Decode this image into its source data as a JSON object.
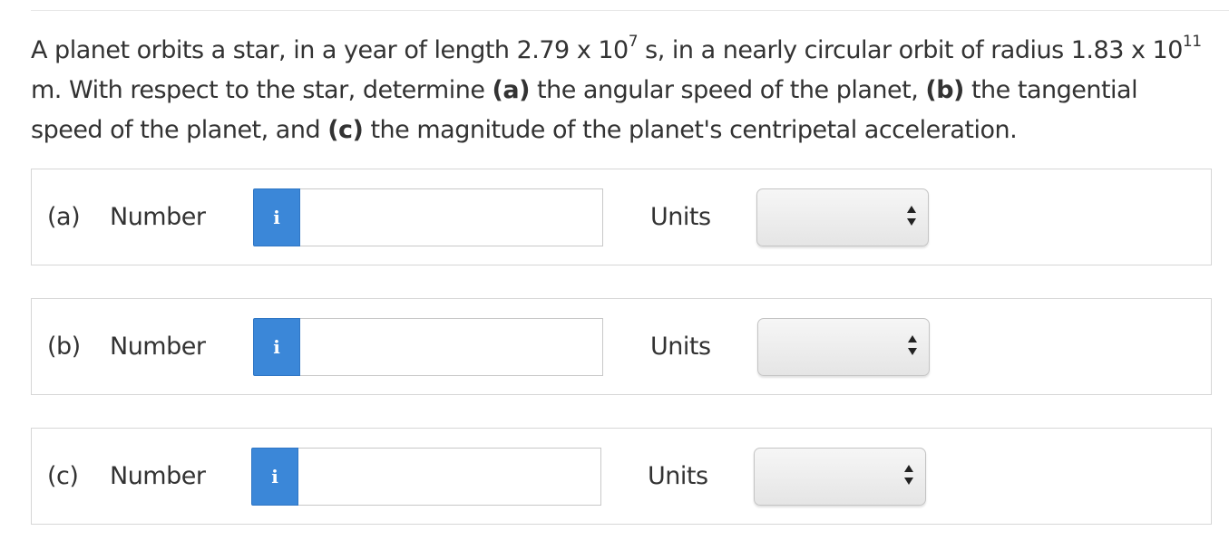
{
  "question": {
    "part1": "A planet orbits a star, in a year of length 2.79 x 10",
    "exp1": "7",
    "part2": " s, in a nearly circular orbit of radius 1.83 x 10",
    "exp2": "11",
    "part3": " m. With respect to the star, determine ",
    "label_a": "(a)",
    "part4": " the angular speed of the planet, ",
    "label_b": "(b)",
    "part5": " the tangential speed of the planet, and ",
    "label_c": "(c)",
    "part6": " the magnitude of the planet's centripetal acceleration."
  },
  "rows": [
    {
      "letter": "(a)",
      "number_label": "Number",
      "info_icon": "i",
      "number_value": "",
      "units_label": "Units",
      "units_value": ""
    },
    {
      "letter": "(b)",
      "number_label": "Number",
      "info_icon": "i",
      "number_value": "",
      "units_label": "Units",
      "units_value": ""
    },
    {
      "letter": "(c)",
      "number_label": "Number",
      "info_icon": "i",
      "number_value": "",
      "units_label": "Units",
      "units_value": ""
    }
  ],
  "colors": {
    "info_button": "#3b87d8",
    "text": "#333333",
    "border": "#d6d6d6"
  }
}
